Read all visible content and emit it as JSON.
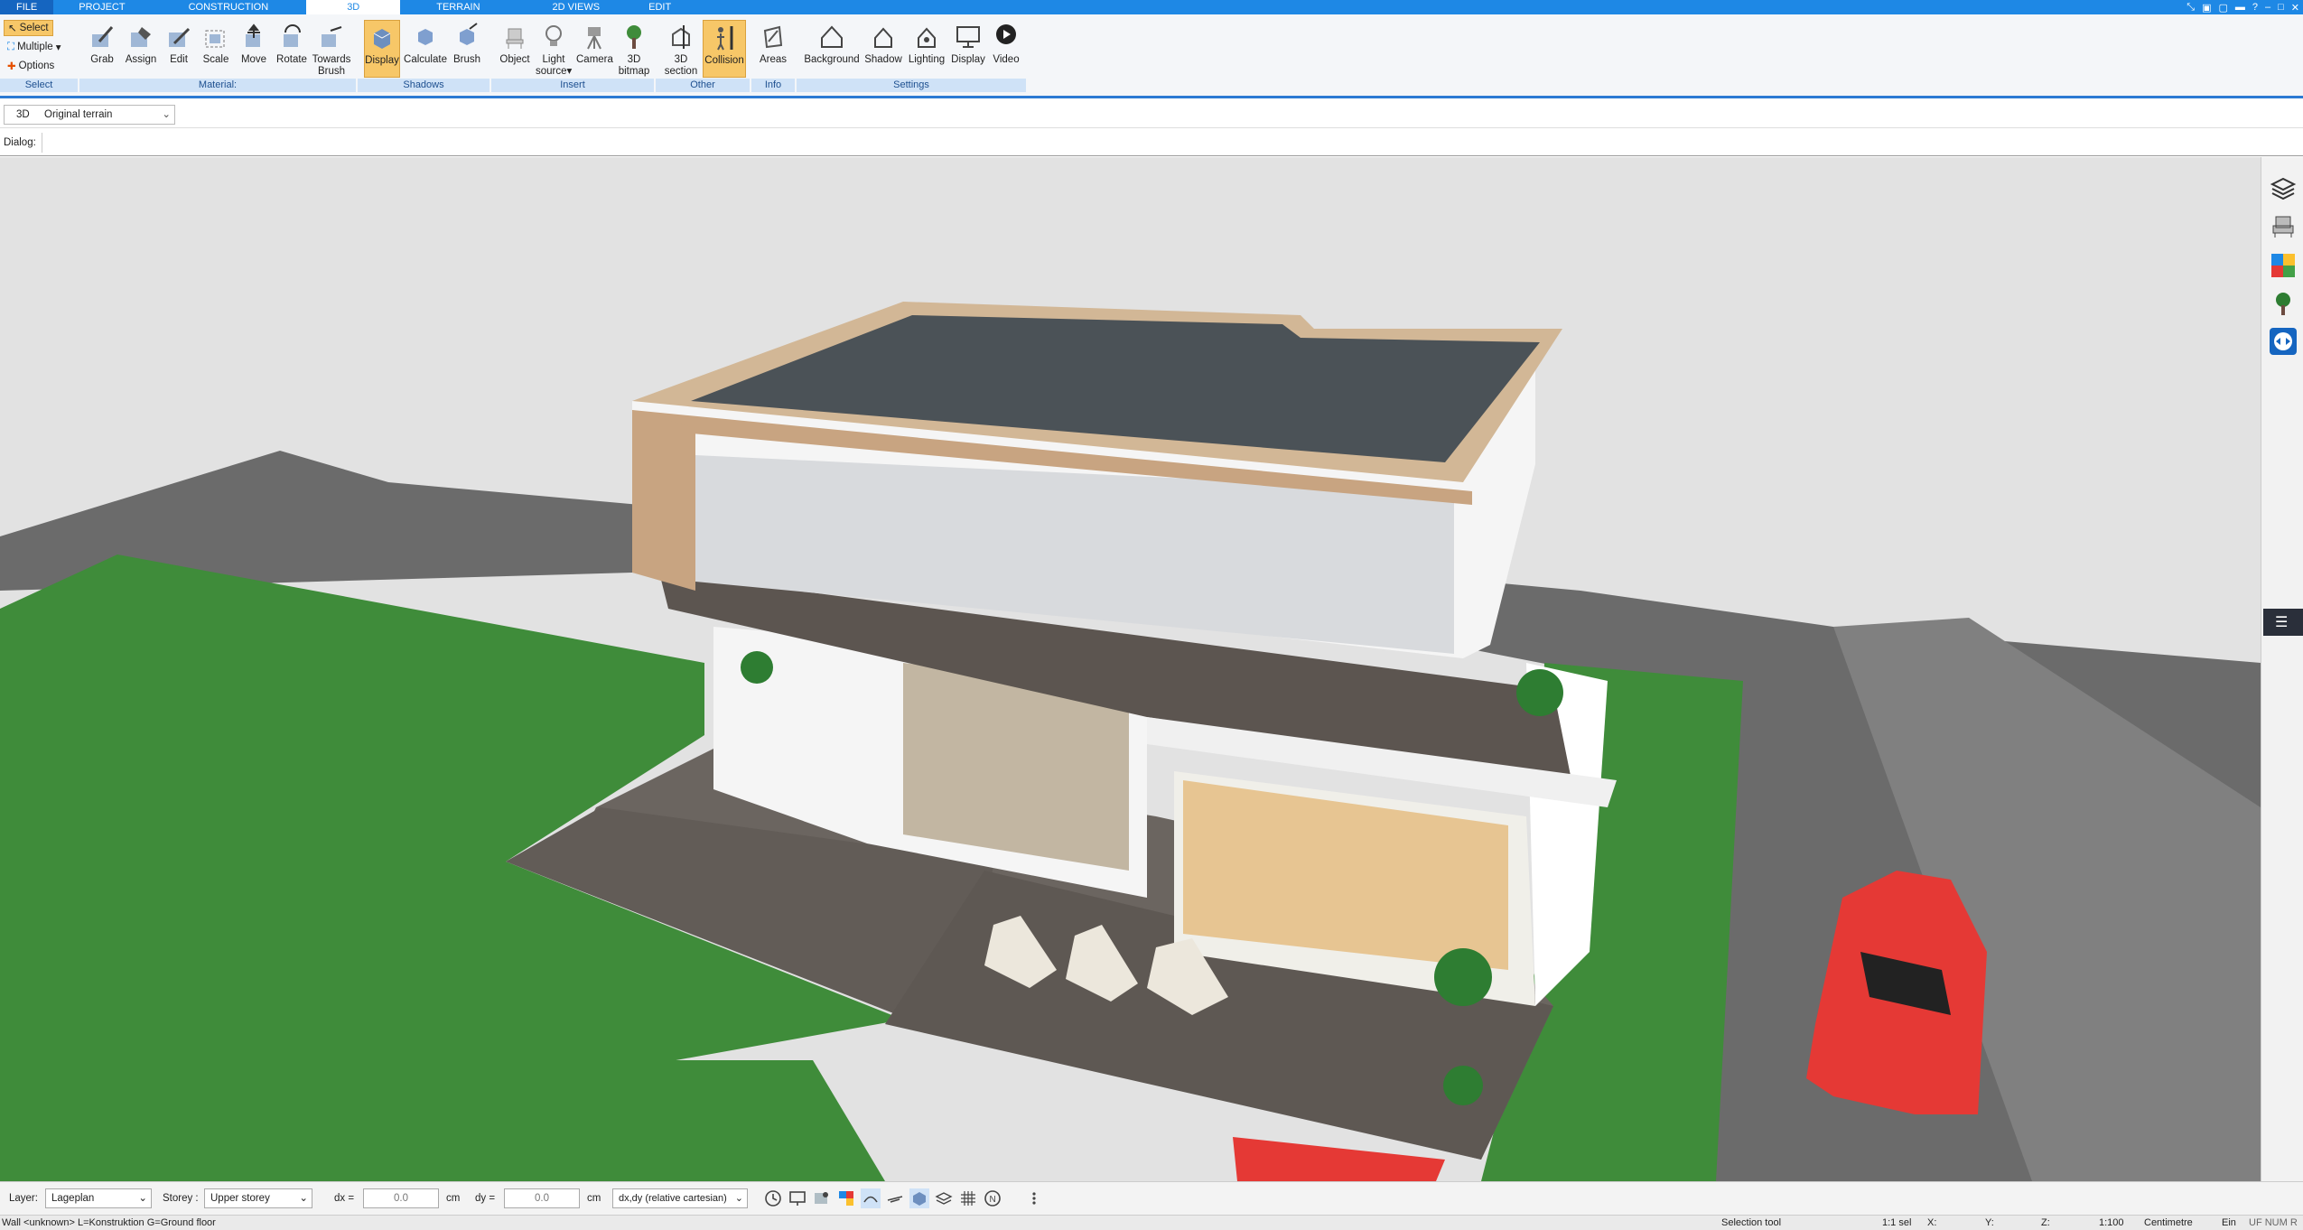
{
  "tabs": [
    {
      "label": "FILE"
    },
    {
      "label": "PROJECT"
    },
    {
      "label": "CONSTRUCTION"
    },
    {
      "label": "3D"
    },
    {
      "label": "TERRAIN"
    },
    {
      "label": "2D VIEWS"
    },
    {
      "label": "EDIT"
    }
  ],
  "active_tab": "3D",
  "ribbon": {
    "select_group": {
      "select": "Select",
      "multiple": "Multiple",
      "options": "Options",
      "group_label": "Select"
    },
    "material": {
      "grab": "Grab",
      "assign": "Assign",
      "edit": "Edit",
      "scale": "Scale",
      "move": "Move",
      "rotate": "Rotate",
      "towards_brush_1": "Towards",
      "towards_brush_2": "Brush",
      "group_label": "Material:"
    },
    "shadows": {
      "display": "Display",
      "calculate": "Calculate",
      "brush": "Brush",
      "group_label": "Shadows"
    },
    "insert": {
      "object": "Object",
      "light_1": "Light",
      "light_2": "source",
      "camera": "Camera",
      "bitmap_1": "3D",
      "bitmap_2": "bitmap",
      "group_label": "Insert"
    },
    "other": {
      "section_1": "3D",
      "section_2": "section",
      "collision": "Collision",
      "group_label": "Other"
    },
    "info": {
      "areas": "Areas",
      "group_label": "Info"
    },
    "settings": {
      "background": "Background",
      "shadow": "Shadow",
      "lighting": "Lighting",
      "display": "Display",
      "video": "Video",
      "group_label": "Settings"
    }
  },
  "view_selector": {
    "mode": "3D",
    "terrain": "Original terrain"
  },
  "dialog_label": "Dialog:",
  "bottom": {
    "layer_label": "Layer:",
    "layer_value": "Lageplan",
    "storey_label": "Storey :",
    "storey_value": "Upper storey",
    "dx_label": "dx =",
    "dx_value": "0.0",
    "dx_unit": "cm",
    "dy_label": "dy =",
    "dy_value": "0.0",
    "dy_unit": "cm",
    "coord_mode": "dx,dy (relative cartesian)"
  },
  "status": {
    "left": "Wall <unknown> L=Konstruktion G=Ground floor",
    "tool": "Selection tool",
    "sel": "1:1 sel",
    "x": "X:",
    "y": "Y:",
    "z": "Z:",
    "scale": "1:100",
    "unit": "Centimetre",
    "ein": "Ein",
    "flags": "UF NUM R"
  },
  "colors": {
    "accent": "#1e88e5",
    "ribbon_bg": "#f4f6f9",
    "active_button": "#f7c768",
    "lawn": "#3f8c3a",
    "deck": "#6b6560",
    "car": "#e53935"
  }
}
